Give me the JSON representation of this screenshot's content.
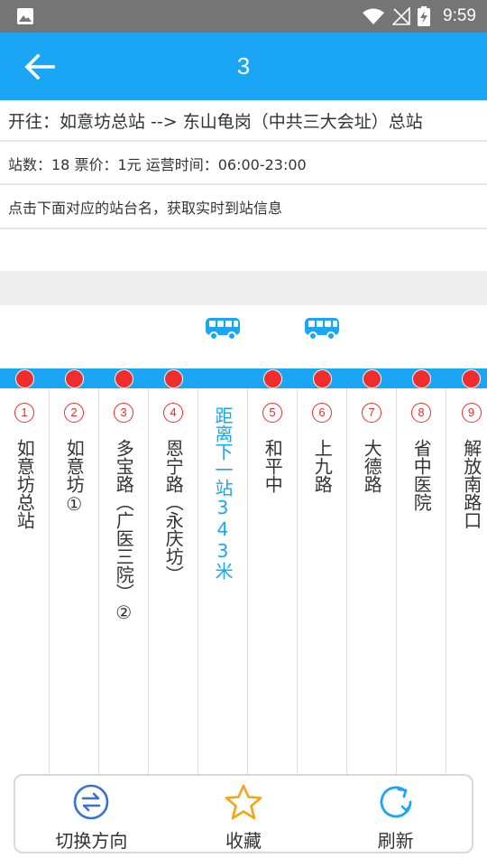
{
  "status_bar": {
    "time": "9:59",
    "icons": [
      "image-icon",
      "wifi-icon",
      "signal-off-icon",
      "battery-charging-icon"
    ]
  },
  "header": {
    "title": "3",
    "back_icon": "arrow-left-icon"
  },
  "route_info": {
    "direction": "开往：如意坊总站 --> 东山龟岗（中共三大会址）总站",
    "meta": "站数：18 票价：1元 运营时间：06:00-23:00",
    "hint": "点击下面对应的站台名，获取实时到站信息"
  },
  "stops": [
    {
      "num": "1",
      "name": "如意坊总站"
    },
    {
      "num": "2",
      "name": "如意坊①"
    },
    {
      "num": "3",
      "name": "多宝路（广医三院）②"
    },
    {
      "num": "4",
      "name": "恩宁路（永庆坊）"
    },
    {
      "num": "5",
      "name": "和平中"
    },
    {
      "num": "6",
      "name": "上九路"
    },
    {
      "num": "7",
      "name": "大德路"
    },
    {
      "num": "8",
      "name": "省中医院"
    },
    {
      "num": "9",
      "name": "解放南路口"
    }
  ],
  "next_stop_info": "距离下一站343米",
  "colors": {
    "accent": "#1aa6f4",
    "stop_red": "#ef2d2d",
    "status_bar": "#757575"
  },
  "actions": {
    "switch_label": "切换方向",
    "favorite_label": "收藏",
    "refresh_label": "刷新",
    "switch_icon": "swap-direction-icon",
    "favorite_icon": "star-icon",
    "refresh_icon": "refresh-icon"
  }
}
